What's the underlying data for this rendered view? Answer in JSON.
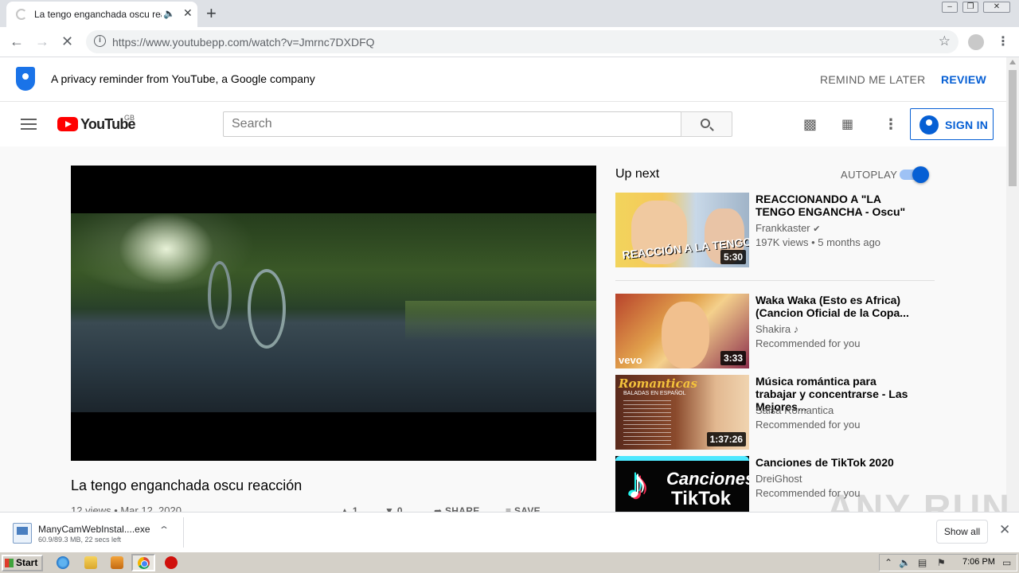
{
  "browser": {
    "tab_title": "La tengo enganchada oscu reac",
    "audio_icon": "speaker-icon",
    "url": "https://www.youtubepp.com/watch?v=Jmrnc7DXDFQ"
  },
  "privacy_banner": {
    "message": "A privacy reminder from YouTube, a Google company",
    "remind_later": "REMIND ME LATER",
    "review": "REVIEW"
  },
  "masthead": {
    "logo_text": "YouTube",
    "country": "GB",
    "search_placeholder": "Search",
    "sign_in": "SIGN IN"
  },
  "video": {
    "title": "La tengo enganchada oscu reacción",
    "meta": "12 views • Mar 12, 2020",
    "likes": "1",
    "dislikes": "0",
    "share": "SHARE",
    "save": "SAVE"
  },
  "sidebar": {
    "up_next": "Up next",
    "autoplay": "AUTOPLAY",
    "autoplay_on": true,
    "items": [
      {
        "title": "REACCIONANDO A \"LA TENGO ENGANCHA - Oscu\"",
        "channel": "Frankkaster",
        "verified": true,
        "stats": "197K views • 5 months ago",
        "duration": "5:30",
        "thumb_text": "REACCIÓN A LA TENGO ENGANCH"
      },
      {
        "title": "Waka Waka (Esto es Africa) (Cancion Oficial de la Copa...",
        "channel": "Shakira",
        "stats": "Recommended for you",
        "duration": "3:33",
        "thumb_text": "vevo"
      },
      {
        "title": "Música romántica para trabajar y concentrarse - Las Mejores...",
        "channel": "Salsa Romantica",
        "stats": "Recommended for you",
        "duration": "1:37:26",
        "thumb_text": "Romanticas",
        "thumb_sub": "BALADAS EN ESPAÑOL"
      },
      {
        "title": "Canciones de TikTok 2020",
        "channel": "DreiGhost",
        "stats": "Recommended for you",
        "thumb_text_1": "Canciones",
        "thumb_text_2": "TikTok"
      }
    ]
  },
  "download_shelf": {
    "file_name": "ManyCamWebInstal....exe",
    "progress": "60.9/89.3 MB, 22 secs left",
    "show_all": "Show all"
  },
  "watermark": "ANY RUN",
  "taskbar": {
    "start": "Start",
    "clock": "7:06 PM"
  },
  "colors": {
    "accent": "#065fd4",
    "youtube_red": "#ff0000"
  }
}
